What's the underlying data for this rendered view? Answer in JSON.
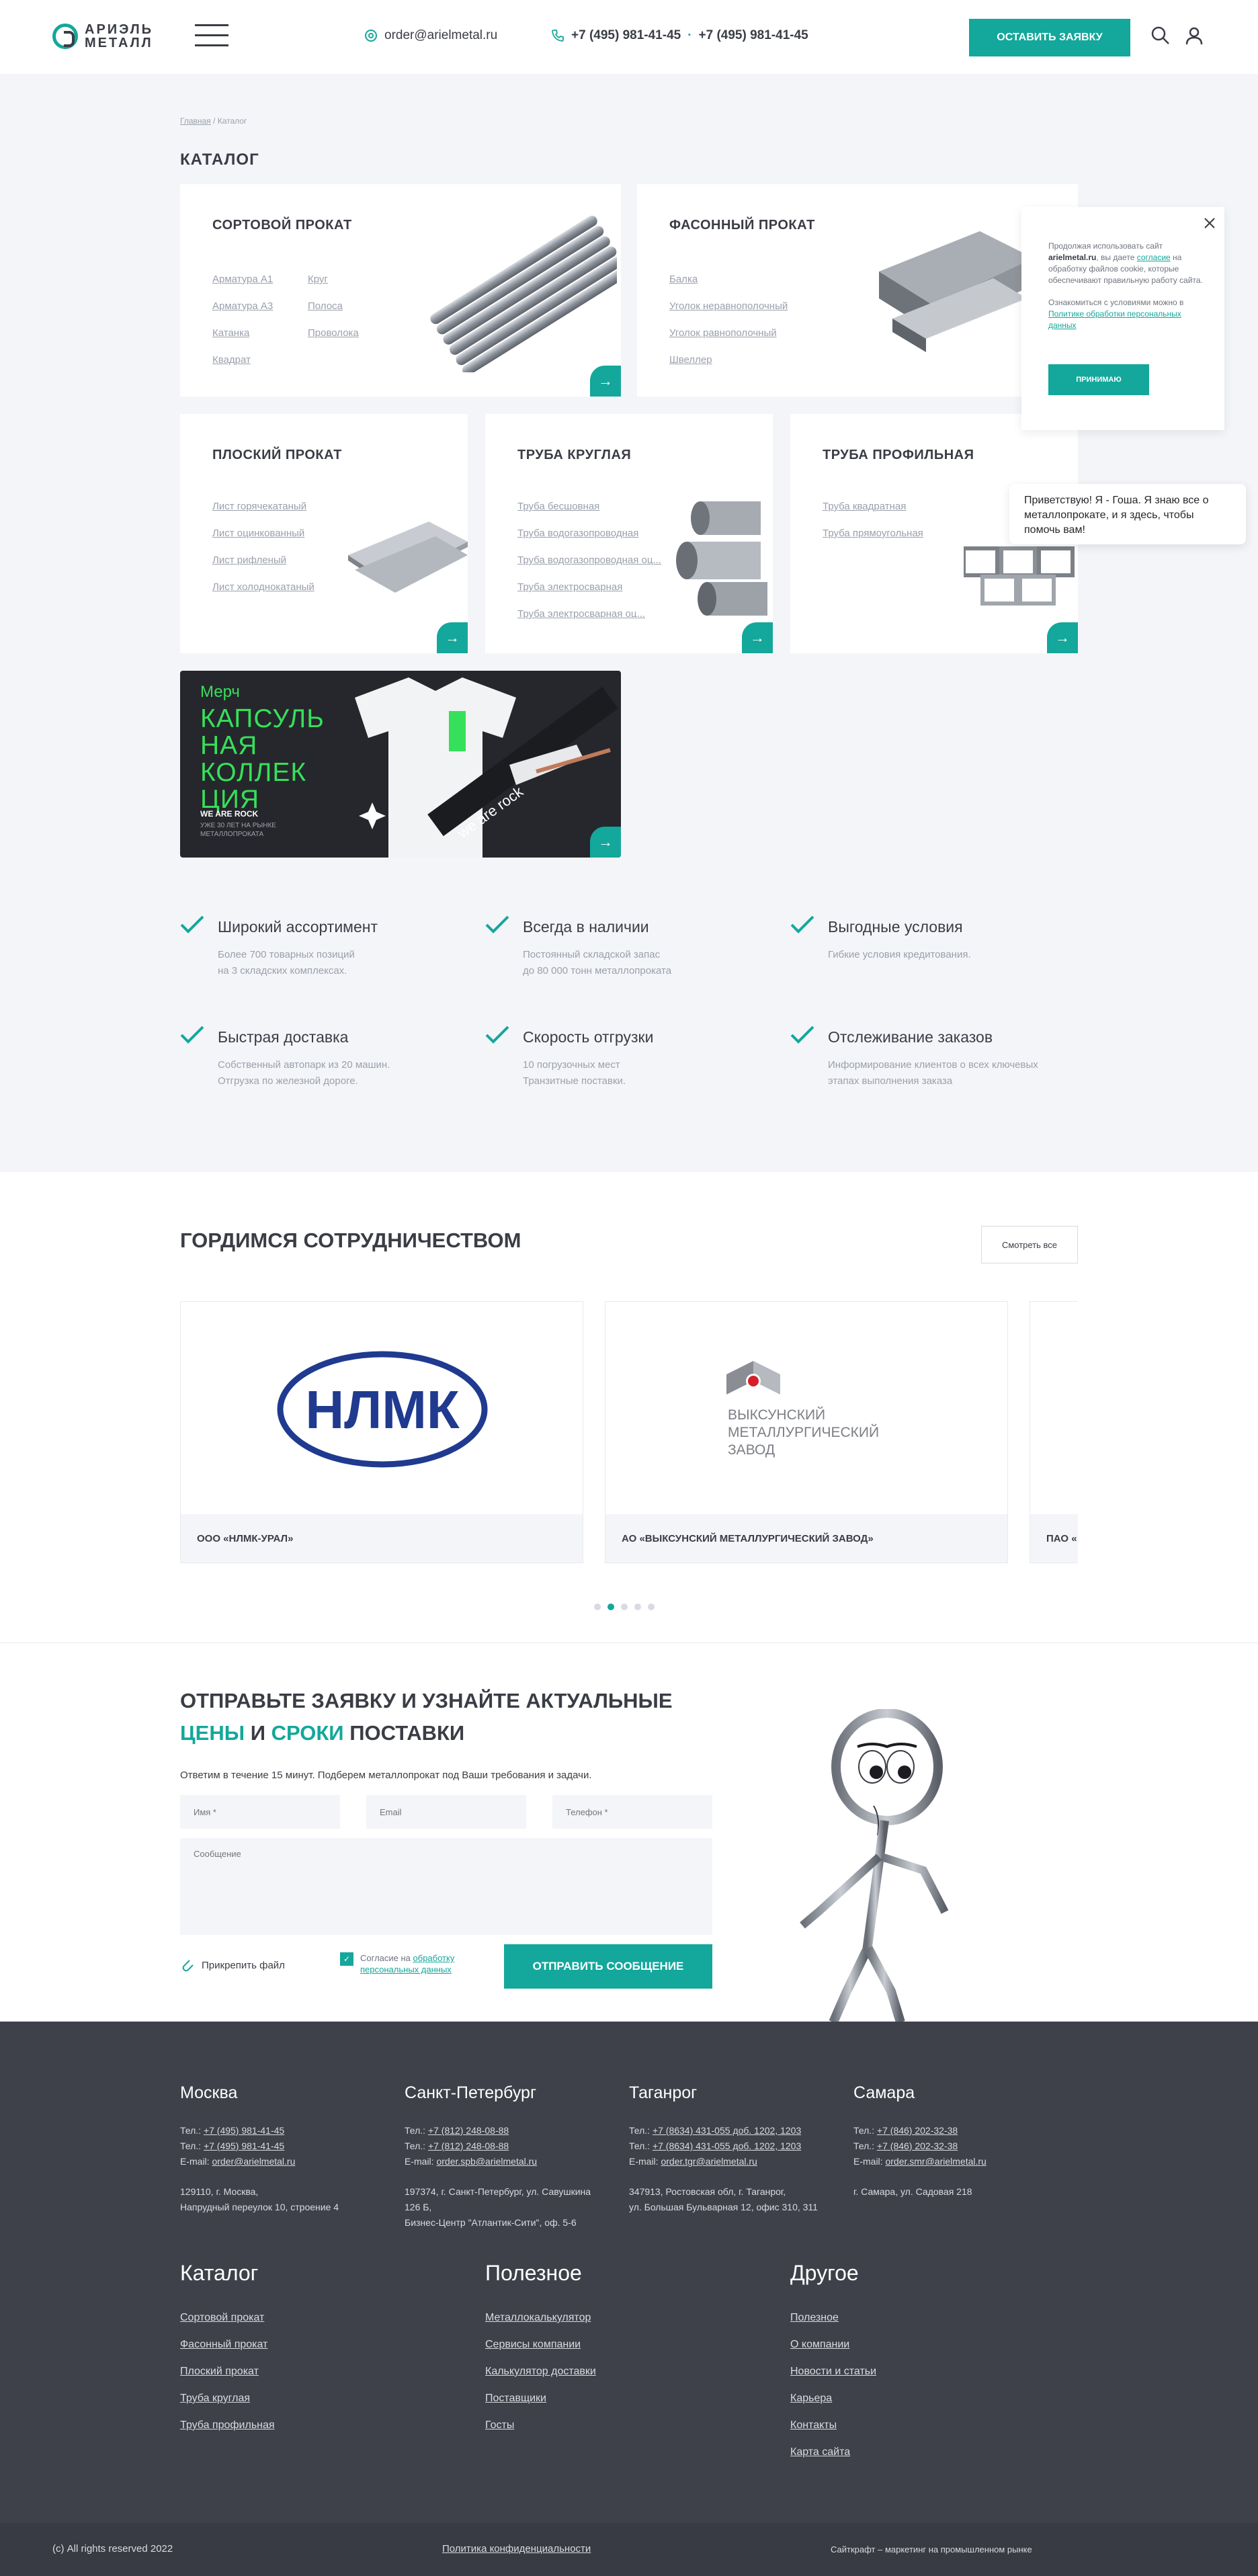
{
  "header": {
    "logo_line1": "АРИЭЛЬ",
    "logo_line2": "МЕТАЛЛ",
    "email": "order@arielmetal.ru",
    "phone1": "+7 (495) 981-41-45",
    "phone2": "+7 (495) 981-41-45",
    "cta": "ОСТАВИТЬ ЗАЯВКУ"
  },
  "breadcrumb": {
    "home": "Главная",
    "sep": "/",
    "current": "Каталог"
  },
  "catalog": {
    "title": "КАТАЛОГ",
    "cards": [
      {
        "title": "СОРТОВОЙ ПРОКАТ",
        "links_col1": [
          "Арматура А1",
          "Арматура А3",
          "Катанка",
          "Квадрат"
        ],
        "links_col2": [
          "Круг",
          "Полоса",
          "Проволока"
        ]
      },
      {
        "title": "ФАСОННЫЙ ПРОКАТ",
        "links_col1": [
          "Балка",
          "Уголок неравнополочный",
          "Уголок равнополочный",
          "Швеллер"
        ]
      },
      {
        "title": "ПЛОСКИЙ ПРОКАТ",
        "links_col1": [
          "Лист горячекатаный",
          "Лист оцинкованный",
          "Лист рифленый",
          "Лист холоднокатаный"
        ]
      },
      {
        "title": "ТРУБА КРУГЛАЯ",
        "links_col1": [
          "Труба бесшовная",
          "Труба водогазопроводная",
          "Труба водогазопроводная оц...",
          "Труба электросварная",
          "Труба электросварная оц..."
        ]
      },
      {
        "title": "ТРУБА ПРОФИЛЬНАЯ",
        "links_col1": [
          "Труба квадратная",
          "Труба прямоугольная"
        ]
      }
    ],
    "merch": {
      "tag": "Мерч",
      "line1": "КАПСУЛЬ",
      "line2": "НАЯ",
      "line3": "КОЛЛЕК",
      "line4": "ЦИЯ",
      "slogan": "WE ARE ROCK",
      "sub1": "УЖЕ 30 ЛЕТ НА РЫНКЕ",
      "sub2": "МЕТАЛЛОПРОКАТА",
      "tshirt_text": "we are rock"
    }
  },
  "cookie": {
    "text1": "Продолжая использовать сайт",
    "site": "arielmetal.ru",
    "text2": ", вы даете",
    "link1": "согласие",
    "text3": "на обработку файлов cookie, которые обеспечивают правильную работу сайта.",
    "text4": "Ознакомиться с условиями можно в",
    "link2": "Политике обработки персональных данных",
    "button": "ПРИНИМАЮ"
  },
  "chat": {
    "message": "Приветствую! Я - Гоша. Я знаю все о металлопрокате, и я здесь, чтобы помочь вам!"
  },
  "features": [
    {
      "title": "Широкий ассортимент",
      "line1": "Более 700 товарных позиций",
      "line2": "на 3 складских комплексах."
    },
    {
      "title": "Всегда в наличии",
      "line1": "Постоянный складской запас",
      "line2": "до 80 000 тонн металлопроката"
    },
    {
      "title": "Выгодные условия",
      "line1": "Гибкие условия кредитования.",
      "line2": ""
    },
    {
      "title": "Быстрая доставка",
      "line1": "Собственный автопарк из 20 машин.",
      "line2": "Отгрузка по железной дороге."
    },
    {
      "title": "Скорость отгрузки",
      "line1": "10 погрузочных мест",
      "line2": "Транзитные поставки."
    },
    {
      "title": "Отслеживание заказов",
      "line1": "Информирование клиентов о всех ключевых",
      "line2": "этапах выполнения заказа"
    }
  ],
  "partners": {
    "title": "ГОРДИМСЯ СОТРУДНИЧЕСТВОМ",
    "see_all": "Смотреть все",
    "items": [
      {
        "name": "ООО «НЛМК-УРАЛ»",
        "logo_text": "НЛМК"
      },
      {
        "name": "АО «ВЫКСУНСКИЙ МЕТАЛЛУРГИЧЕСКИЙ ЗАВОД»",
        "logo_line1": "ВЫКСУНСКИЙ",
        "logo_line2": "МЕТАЛЛУРГИЧЕСКИЙ",
        "logo_line3": "ЗАВОД"
      },
      {
        "name": "ПАО «"
      }
    ],
    "active_dot": 1
  },
  "form": {
    "title_line1": "ОТПРАВЬТЕ ЗАЯВКУ И УЗНАЙТЕ АКТУАЛЬНЫЕ",
    "w_prices": "ЦЕНЫ",
    "w_and": "И",
    "w_terms": "СРОКИ",
    "w_delivery": "ПОСТАВКИ",
    "subtitle": "Ответим в течение 15 минут. Подберем металлопрокат под Ваши требования и задачи.",
    "name_ph": "Имя *",
    "email_ph": "Email",
    "phone_ph": "Телефон *",
    "message_ph": "Сообщение",
    "attach": "Прикрепить файл",
    "consent1": "Согласие на",
    "consent_link": "обработку персональных данных",
    "submit": "ОТПРАВИТЬ СООБЩЕНИЕ"
  },
  "footer": {
    "cities": [
      {
        "name": "Москва",
        "tel1_label": "Тел.:",
        "tel1": "+7 (495) 981-41-45",
        "tel2": "+7 (495) 981-41-45",
        "email_label": "E-mail:",
        "email": "order@arielmetal.ru",
        "addr1": "129110, г. Москва,",
        "addr2": "Напрудный переулок 10, строение 4",
        "addr3": ""
      },
      {
        "name": "Санкт-Петербург",
        "tel1_label": "Тел.:",
        "tel1": "+7 (812) 248-08-88",
        "tel2": "+7 (812) 248-08-88",
        "email_label": "E-mail:",
        "email": "order.spb@arielmetal.ru",
        "addr1": "197374, г. Санкт-Петербург, ул. Савушкина",
        "addr2": "126 Б,",
        "addr3": "Бизнес-Центр \"Атлантик-Сити\", оф. 5-6"
      },
      {
        "name": "Таганрог",
        "tel1_label": "Тел.:",
        "tel1": "+7 (8634) 431-055 доб. 1202, 1203",
        "tel2": "+7 (8634) 431-055 доб. 1202, 1203",
        "email_label": "E-mail:",
        "email": "order.tgr@arielmetal.ru",
        "addr1": "347913, Ростовская обл, г. Таганрог,",
        "addr2": "ул. Большая Бульварная 12, офис 310, 311",
        "addr3": ""
      },
      {
        "name": "Самара",
        "tel1_label": "Тел.:",
        "tel1": "+7 (846) 202-32-38",
        "tel2": "+7 (846) 202-32-38",
        "email_label": "E-mail:",
        "email": "order.smr@arielmetal.ru",
        "addr1": "г. Самара, ул. Садовая 218",
        "addr2": "",
        "addr3": ""
      }
    ],
    "cols": [
      {
        "title": "Каталог",
        "items": [
          "Сортовой прокат",
          "Фасонный прокат",
          "Плоский прокат",
          "Труба круглая",
          "Труба профильная"
        ]
      },
      {
        "title": "Полезное",
        "items": [
          "Металлокалькулятор",
          "Сервисы компании",
          "Калькулятор доставки",
          "Поставщики",
          "Госты"
        ]
      },
      {
        "title": "Другое",
        "items": [
          "Полезное",
          "О компании",
          "Новости и статьи",
          "Карьера",
          "Контакты",
          "Карта сайта"
        ]
      }
    ],
    "copyright": "(с) All rights reserved 2022",
    "privacy": "Политика конфиденциальности",
    "made_by": "Сайткрафт – маркетинг на промышленном рынке"
  },
  "colors": {
    "accent": "#14a79b",
    "dark": "#3a3d45",
    "footer": "#3e414a"
  }
}
